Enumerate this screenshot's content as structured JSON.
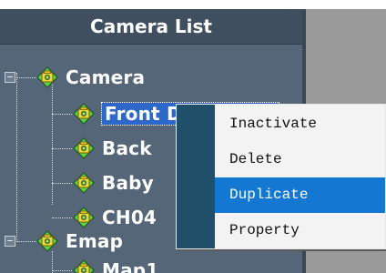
{
  "panel": {
    "title": "Camera List"
  },
  "tree": {
    "groups": [
      {
        "label": "Camera",
        "expander": "−",
        "children": [
          {
            "label": "Front Door - 192",
            "selected": true
          },
          {
            "label": "Back"
          },
          {
            "label": "Baby"
          },
          {
            "label": "CH04"
          }
        ]
      },
      {
        "label": "Emap",
        "expander": "−",
        "children": [
          {
            "label": "Map1"
          }
        ]
      }
    ]
  },
  "context_menu": {
    "items": [
      {
        "label": "Inactivate"
      },
      {
        "label": "Delete"
      },
      {
        "label": "Duplicate",
        "highlighted": true
      },
      {
        "label": "Property"
      }
    ]
  },
  "colors": {
    "panel_bg": "#556678",
    "header_bg": "#3f4f60",
    "selection_bg": "#2d67c9",
    "menu_highlight": "#1478d2",
    "menu_gutter": "#204f69",
    "icon_green": "#5bd143",
    "icon_yellow": "#f0d93c"
  },
  "icons": {
    "camera_node": "camera-icon"
  }
}
